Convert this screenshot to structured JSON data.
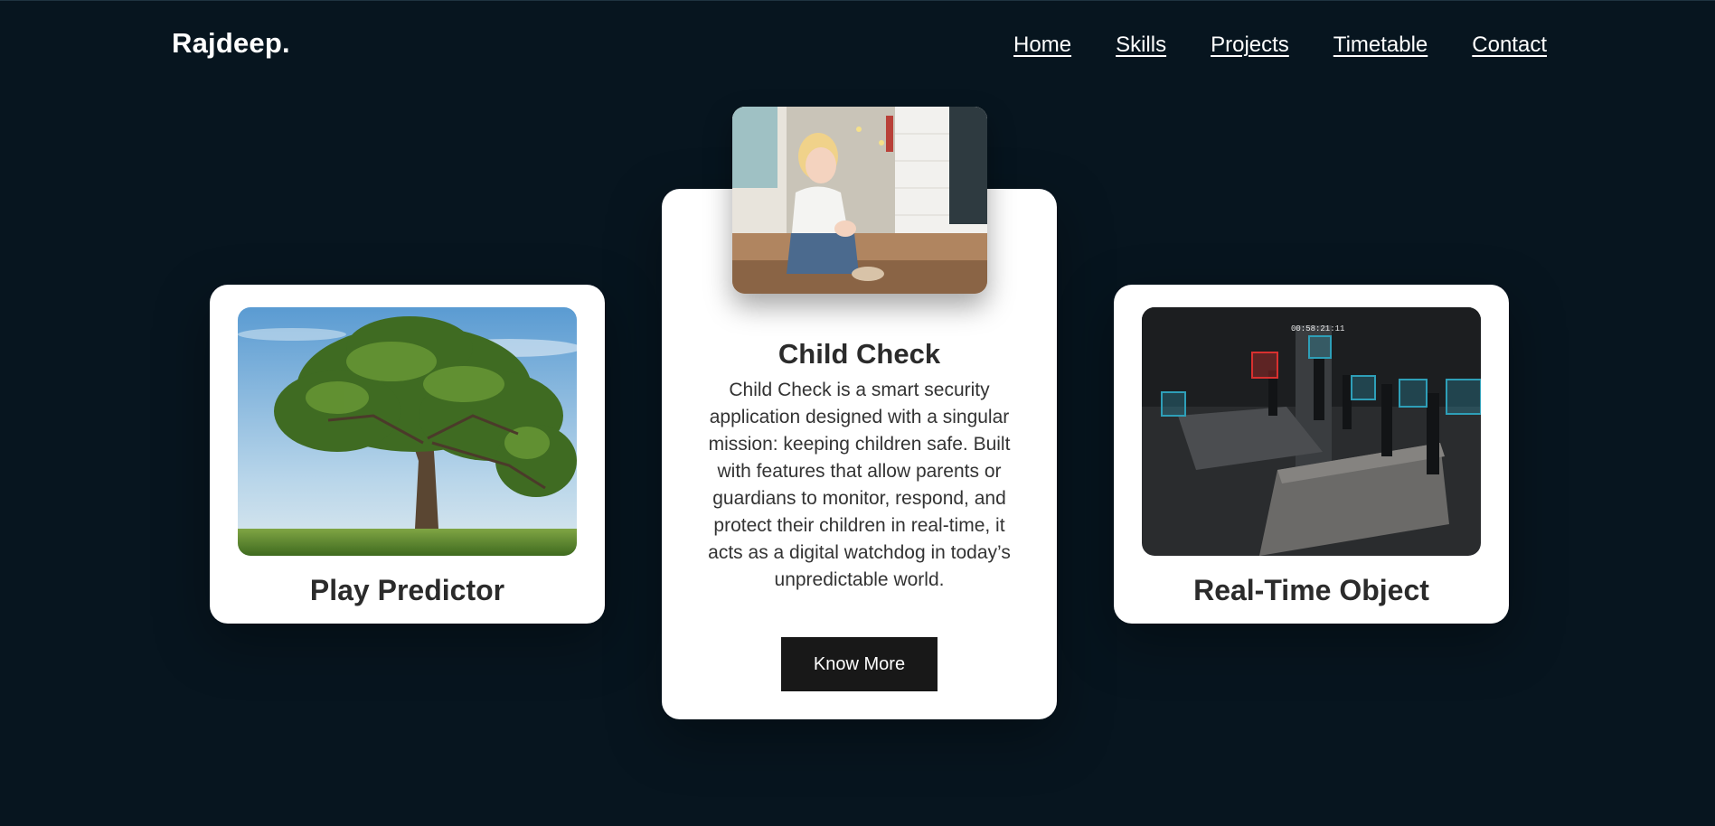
{
  "nav": {
    "logo": "Rajdeep.",
    "links": [
      "Home",
      "Skills",
      "Projects",
      "Timetable",
      "Contact"
    ]
  },
  "cards": {
    "left": {
      "title": "Play Predictor",
      "image": "tree-photo"
    },
    "center": {
      "title": "Child Check",
      "image": "child-photo",
      "description": "Child Check is a smart security application designed with a singular mission: keeping children safe. Built with features that allow parents or guardians to monitor, respond, and protect their children in real-time, it acts as a digital watchdog in today’s unpredictable world.",
      "button": "Know More"
    },
    "right": {
      "title": "Real-Time Object",
      "image": "cctv-detection-photo",
      "timestamp": "00:58:21:11"
    }
  },
  "colors": {
    "background": "#07151f",
    "card": "#ffffff",
    "button": "#181818",
    "title": "#2b2b2b"
  }
}
